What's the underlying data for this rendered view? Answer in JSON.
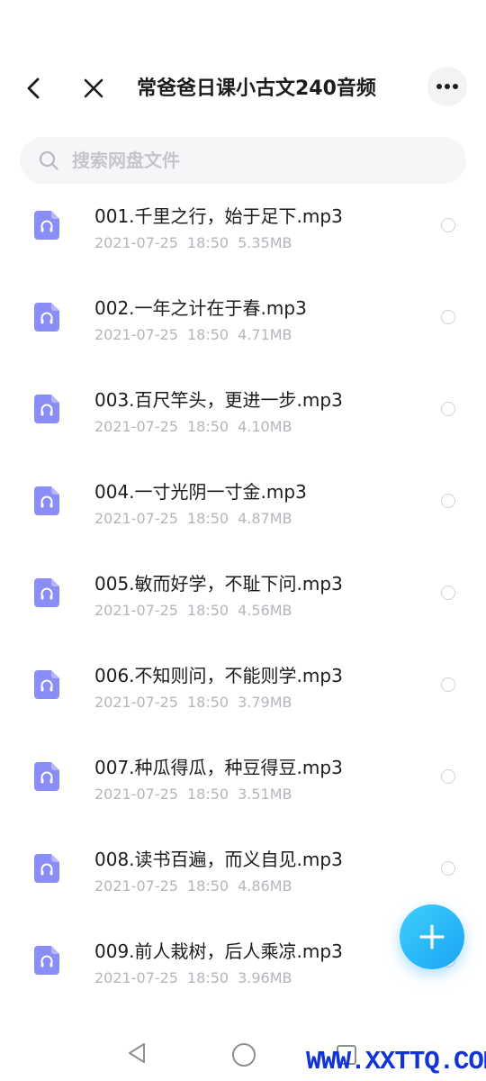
{
  "status_bar": {
    "left": "",
    "right": ""
  },
  "header": {
    "title": "常爸爸日课小古文240音频"
  },
  "search": {
    "placeholder": "搜索网盘文件"
  },
  "files": [
    {
      "name": "001.千里之行，始于足下.mp3",
      "date": "2021-07-25",
      "time": "18:50",
      "size": "5.35MB"
    },
    {
      "name": "002.一年之计在于春.mp3",
      "date": "2021-07-25",
      "time": "18:50",
      "size": "4.71MB"
    },
    {
      "name": "003.百尺竿头，更进一步.mp3",
      "date": "2021-07-25",
      "time": "18:50",
      "size": "4.10MB"
    },
    {
      "name": "004.一寸光阴一寸金.mp3",
      "date": "2021-07-25",
      "time": "18:50",
      "size": "4.87MB"
    },
    {
      "name": "005.敏而好学，不耻下问.mp3",
      "date": "2021-07-25",
      "time": "18:50",
      "size": "4.56MB"
    },
    {
      "name": "006.不知则问，不能则学.mp3",
      "date": "2021-07-25",
      "time": "18:50",
      "size": "3.79MB"
    },
    {
      "name": "007.种瓜得瓜，种豆得豆.mp3",
      "date": "2021-07-25",
      "time": "18:50",
      "size": "3.51MB"
    },
    {
      "name": "008.读书百遍，而义自见.mp3",
      "date": "2021-07-25",
      "time": "18:50",
      "size": "4.86MB"
    },
    {
      "name": "009.前人栽树，后人乘凉.mp3",
      "date": "2021-07-25",
      "time": "18:50",
      "size": "3.96MB"
    }
  ],
  "icons": {
    "back": "chevron-left-icon",
    "close": "close-icon",
    "more": "more-horizontal-icon",
    "search": "search-icon",
    "file": "audio-file-icon",
    "fab": "plus-icon"
  },
  "colors": {
    "file_icon": "#8a8df5",
    "fab": "#1aa3f5",
    "meta_text": "#b3b6bc"
  },
  "watermark": "WWW.XXTTQ.COM"
}
